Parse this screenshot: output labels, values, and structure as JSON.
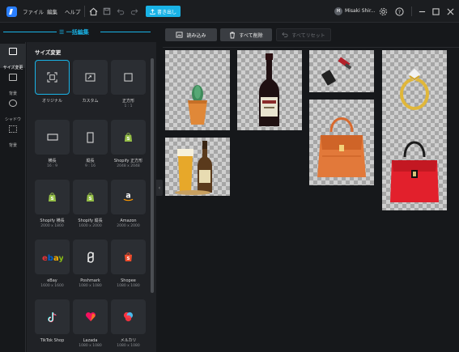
{
  "menu": [
    "ファイル",
    "編集",
    "ヘルプ"
  ],
  "toolbar": {
    "export_label": "書き出し"
  },
  "user": {
    "initial": "M",
    "name": "Misaki Shir..."
  },
  "panel": {
    "title": "一括編集",
    "section_title": "サイズ変更"
  },
  "rail": [
    {
      "label": "サイズ変更",
      "icon": "resize-icon",
      "active": true
    },
    {
      "label": "背景",
      "icon": "background-icon",
      "active": false
    },
    {
      "label": "シャドウ",
      "icon": "shadow-icon",
      "active": false
    },
    {
      "label": "背景",
      "icon": "background-pattern-icon",
      "active": false
    }
  ],
  "presets": [
    {
      "label": "オリジナル",
      "sub": "",
      "icon": "original-icon",
      "selected": true
    },
    {
      "label": "カスタム",
      "sub": "",
      "icon": "custom-icon"
    },
    {
      "label": "正方形",
      "sub": "1 : 1",
      "icon": "square-icon"
    },
    {
      "label": "横長",
      "sub": "16 : 9",
      "icon": "landscape-icon"
    },
    {
      "label": "縦長",
      "sub": "9 : 16",
      "icon": "portrait-icon"
    },
    {
      "label": "Shopify 正方形",
      "sub": "2048 x 2048",
      "icon": "shopify-icon"
    },
    {
      "label": "Shopify 横長",
      "sub": "2000 x 1800",
      "icon": "shopify-icon"
    },
    {
      "label": "Shopify 縦長",
      "sub": "1600 x 2000",
      "icon": "shopify-icon"
    },
    {
      "label": "Amazon",
      "sub": "2000 x 2000",
      "icon": "amazon-icon"
    },
    {
      "label": "eBay",
      "sub": "1600 x 1600",
      "icon": "ebay-icon"
    },
    {
      "label": "Poshmark",
      "sub": "1080 x 1080",
      "icon": "poshmark-icon"
    },
    {
      "label": "Shopee",
      "sub": "1080 x 1080",
      "icon": "shopee-icon"
    },
    {
      "label": "TikTok Shop",
      "sub": "",
      "icon": "tiktok-icon"
    },
    {
      "label": "Lazada",
      "sub": "1080 x 1080",
      "icon": "lazada-icon"
    },
    {
      "label": "メルカリ",
      "sub": "1080 x 1080",
      "icon": "mercari-icon"
    }
  ],
  "actions": {
    "load": "読み込み",
    "delete_all": "すべて削除",
    "reset_all": "すべてリセット"
  },
  "images": [
    "cactus",
    "wine-bottle",
    "lipstick",
    "diamond-ring",
    "beer",
    "orange-handbag",
    "red-handbag"
  ],
  "colors": {
    "accent": "#19b3e6",
    "bg": "#16181b",
    "panel": "#202226"
  }
}
